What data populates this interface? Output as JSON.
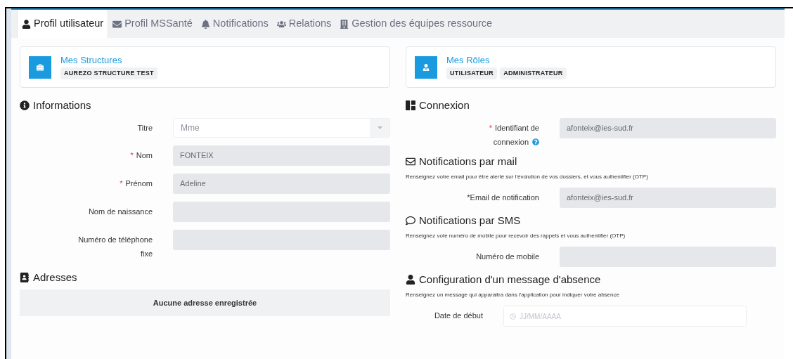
{
  "tabs": [
    {
      "label": "Profil utilisateur",
      "selected": true
    },
    {
      "label": "Profil MSSanté",
      "selected": false
    },
    {
      "label": "Notifications",
      "selected": false
    },
    {
      "label": "Relations",
      "selected": false
    },
    {
      "label": "Gestion des équipes ressource",
      "selected": false
    }
  ],
  "left": {
    "card": {
      "title": "Mes Structures",
      "badges": [
        "AUREZO STRUCTURE TEST"
      ]
    },
    "informations": {
      "title": "Informations",
      "fields": [
        {
          "kind": "select",
          "label": "Titre",
          "value": "Mme"
        },
        {
          "kind": "text",
          "required_mark": "*",
          "label": "Nom",
          "value": "FONTEIX"
        },
        {
          "kind": "text",
          "required_mark": "*",
          "label": "Prénom",
          "value": "Adeline"
        },
        {
          "kind": "text",
          "label": "Nom de naissance"
        },
        {
          "kind": "text",
          "label": "Numéro de téléphone fixe"
        }
      ]
    },
    "adresses": {
      "title": "Adresses",
      "empty_message": "Aucune adresse enregistrée"
    }
  },
  "right": {
    "card": {
      "title": "Mes Rôles",
      "badges": [
        "UTILISATEUR",
        "ADMINISTRATEUR"
      ]
    },
    "sections": [
      {
        "title": "Connexion",
        "fields": [
          {
            "kind": "text",
            "required_mark": "*",
            "label": "Identifiant de connexion",
            "help": true,
            "value": "afonteix@ies-sud.fr"
          }
        ]
      },
      {
        "title": "Notifications par mail",
        "description": "Renseignez votre email pour être alerté sur l'évolution de vos dossiers, et vous authentifier (OTP)",
        "fields": [
          {
            "kind": "text",
            "label": "*Email de notification",
            "value": "afonteix@ies-sud.fr"
          }
        ]
      },
      {
        "title": "Notifications par SMS",
        "description": "Renseignez vote numéro de mobile pour recevoir des rappels et vous authentifier (OTP)",
        "fields": [
          {
            "kind": "text",
            "label": "Numéro de mobile"
          }
        ]
      },
      {
        "title": "Configuration d'un message d'absence",
        "description": "Renseignez un message qui apparaitra dans l'application pour indiquer votre absence",
        "fields": [
          {
            "kind": "date",
            "label": "Date de début",
            "placeholder": "JJ/MM/AAAA"
          }
        ]
      }
    ]
  }
}
